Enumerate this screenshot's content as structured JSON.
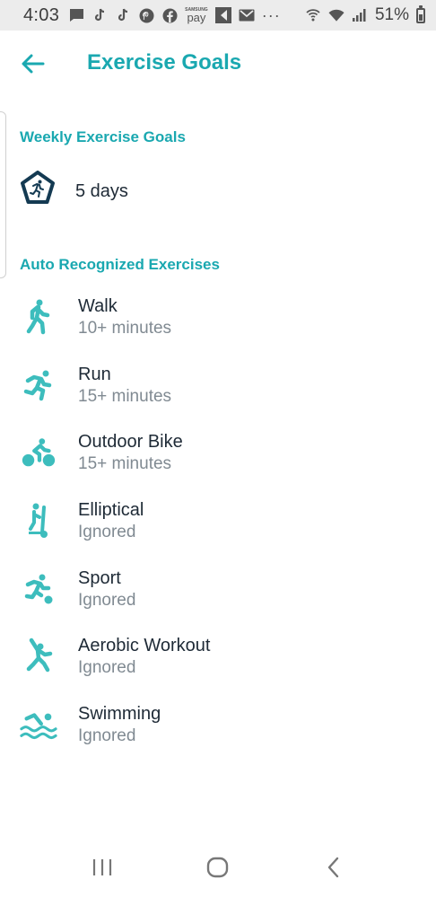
{
  "status_bar": {
    "time": "4:03",
    "pay_label_top": "SAMSUNG",
    "pay_label": "pay",
    "overflow": "···",
    "battery_pct": "51%"
  },
  "header": {
    "title": "Exercise Goals"
  },
  "weekly": {
    "title": "Weekly Exercise Goals",
    "value": "5 days"
  },
  "auto": {
    "title": "Auto Recognized Exercises",
    "items": [
      {
        "name": "Walk",
        "detail": "10+ minutes",
        "icon": "walk-icon"
      },
      {
        "name": "Run",
        "detail": "15+ minutes",
        "icon": "run-icon"
      },
      {
        "name": "Outdoor Bike",
        "detail": "15+ minutes",
        "icon": "bike-icon"
      },
      {
        "name": "Elliptical",
        "detail": "Ignored",
        "icon": "elliptical-icon"
      },
      {
        "name": "Sport",
        "detail": "Ignored",
        "icon": "sport-icon"
      },
      {
        "name": "Aerobic Workout",
        "detail": "Ignored",
        "icon": "aerobic-icon"
      },
      {
        "name": "Swimming",
        "detail": "Ignored",
        "icon": "swimming-icon"
      }
    ]
  },
  "colors": {
    "accent": "#1aa8b0",
    "icon": "#3dbdbd",
    "badge": "#143a52",
    "text": "#1e2a36",
    "secondary": "#808a92"
  }
}
